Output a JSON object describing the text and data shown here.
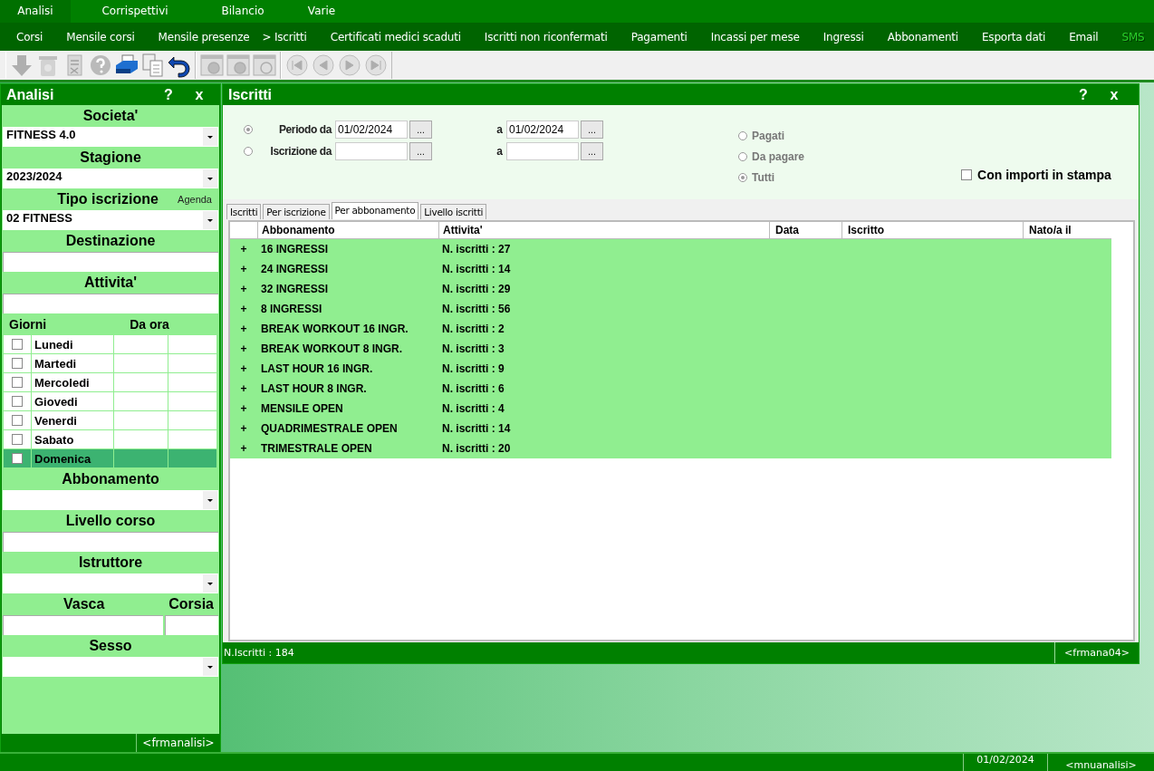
{
  "menu": [
    {
      "label": "Analisi",
      "selected": true
    },
    {
      "label": "Corrispettivi",
      "selected": false
    },
    {
      "label": "Bilancio",
      "selected": false
    },
    {
      "label": "Varie",
      "selected": false
    }
  ],
  "submenu": [
    {
      "label": "Corsi",
      "disabled": false
    },
    {
      "label": "Mensile corsi",
      "disabled": false
    },
    {
      "label": "Mensile presenze",
      "disabled": false
    },
    {
      "label": "> Iscritti",
      "disabled": false
    },
    {
      "label": "Certificati medici scaduti",
      "disabled": false
    },
    {
      "label": "Iscritti non riconfermati",
      "disabled": false
    },
    {
      "label": "Pagamenti",
      "disabled": false
    },
    {
      "label": "Incassi per mese",
      "disabled": false
    },
    {
      "label": "Ingressi",
      "disabled": false
    },
    {
      "label": "Abbonamenti",
      "disabled": false
    },
    {
      "label": "Esporta dati",
      "disabled": false
    },
    {
      "label": "Email",
      "disabled": false
    },
    {
      "label": "SMS",
      "disabled": true
    }
  ],
  "toolbar": [
    [
      {
        "kind": "down",
        "disabled": true
      },
      {
        "kind": "trash",
        "disabled": true
      },
      {
        "kind": "doc",
        "disabled": true
      },
      {
        "kind": "help",
        "disabled": true
      },
      {
        "kind": "print",
        "disabled": false
      },
      {
        "kind": "copy",
        "disabled": false
      },
      {
        "kind": "undo",
        "disabled": false
      }
    ],
    [
      {
        "kind": "winrefresh",
        "disabled": true
      },
      {
        "kind": "winhelp",
        "disabled": true
      },
      {
        "kind": "winsearch",
        "disabled": true
      }
    ],
    [
      {
        "kind": "first",
        "disabled": true
      },
      {
        "kind": "prev",
        "disabled": true
      },
      {
        "kind": "next",
        "disabled": true
      },
      {
        "kind": "last",
        "disabled": true
      }
    ]
  ],
  "left_panel": {
    "title": "Analisi",
    "help": "?",
    "close": "x",
    "sections": [
      {
        "label": "Societa'",
        "field": {
          "kind": "select",
          "selected_option": "FITNESS 4.0"
        }
      },
      {
        "label": "Stagione",
        "field": {
          "kind": "select",
          "selected_option": "2023/2024"
        }
      },
      {
        "label": "Tipo iscrizione",
        "extra": "Agenda",
        "field": {
          "kind": "select",
          "selected_option": "02 FITNESS"
        }
      },
      {
        "label": "Destinazione",
        "field": {
          "kind": "input"
        }
      },
      {
        "label": "Attivita'",
        "field": {
          "kind": "input"
        }
      }
    ],
    "days_header": [
      "Giorni",
      "Da ora"
    ],
    "days": [
      {
        "label": "Lunedi",
        "checked": false,
        "selected": false
      },
      {
        "label": "Martedi",
        "checked": false,
        "selected": false
      },
      {
        "label": "Mercoledi",
        "checked": false,
        "selected": false
      },
      {
        "label": "Giovedi",
        "checked": false,
        "selected": false
      },
      {
        "label": "Venerdi",
        "checked": false,
        "selected": false
      },
      {
        "label": "Sabato",
        "checked": false,
        "selected": false
      },
      {
        "label": "Domenica",
        "checked": false,
        "selected": true
      }
    ],
    "sections_2": [
      {
        "label": "Abbonamento",
        "kind": "select"
      },
      {
        "label": "Livello corso",
        "kind": "input"
      },
      {
        "label": "Istruttore",
        "kind": "select"
      }
    ],
    "vasca": "Vasca",
    "corsia": "Corsia",
    "sections_3": [
      {
        "label": "Sesso",
        "kind": "select"
      }
    ],
    "footer": "<frmanalisi>"
  },
  "window": {
    "title": "Iscritti",
    "help": "?",
    "close": "x",
    "date_rows": [
      {
        "label": "Periodo da",
        "selected": true,
        "from": "01/02/2024",
        "to_label": "a",
        "to": "01/02/2024",
        "button": "..."
      },
      {
        "label": "Iscrizione da",
        "selected": false,
        "to_label": "a",
        "button": "..."
      }
    ],
    "payment": [
      {
        "label": "Pagati",
        "selected": false
      },
      {
        "label": "Da pagare",
        "selected": false
      },
      {
        "label": "Tutti",
        "selected": true
      }
    ],
    "print_amounts": {
      "label": "Con importi in stampa",
      "checked": false
    },
    "tabs": [
      {
        "label": "Iscritti",
        "selected": false
      },
      {
        "label": "Per iscrizione",
        "selected": false
      },
      {
        "label": "Per abbonamento",
        "selected": true
      },
      {
        "label": "Livello iscritti",
        "selected": false
      }
    ],
    "table": {
      "columns": [
        "Abbonamento",
        "Attivita'",
        "Data",
        "Iscritto",
        "Nato/a il"
      ],
      "rows": [
        {
          "expander": "+",
          "name": "16 INGRESSI",
          "count": "N. iscritti : 27",
          "expanded": false
        },
        {
          "expander": "+",
          "name": "24 INGRESSI",
          "count": "N. iscritti : 14",
          "expanded": false
        },
        {
          "expander": "+",
          "name": "32 INGRESSI",
          "count": "N. iscritti : 29",
          "expanded": false
        },
        {
          "expander": "+",
          "name": "8 INGRESSI",
          "count": "N. iscritti : 56",
          "expanded": false
        },
        {
          "expander": "+",
          "name": "BREAK WORKOUT 16 INGR.",
          "count": "N. iscritti : 2",
          "expanded": false
        },
        {
          "expander": "+",
          "name": "BREAK WORKOUT 8 INGR.",
          "count": "N. iscritti : 3",
          "expanded": false
        },
        {
          "expander": "+",
          "name": "LAST HOUR 16 INGR.",
          "count": "N. iscritti : 9",
          "expanded": false
        },
        {
          "expander": "+",
          "name": "LAST HOUR 8 INGR.",
          "count": "N. iscritti : 6",
          "expanded": false
        },
        {
          "expander": "+",
          "name": "MENSILE OPEN",
          "count": "N. iscritti : 4",
          "expanded": false
        },
        {
          "expander": "+",
          "name": "QUADRIMESTRALE OPEN",
          "count": "N. iscritti : 14",
          "expanded": false
        },
        {
          "expander": "+",
          "name": "TRIMESTRALE OPEN",
          "count": "N. iscritti : 20",
          "expanded": false
        }
      ]
    },
    "status": "N.Iscritti : 184",
    "form": "<frmana04>"
  },
  "status_bar": {
    "date": "01/02/2024",
    "menu": "<mnuanalisi>"
  }
}
